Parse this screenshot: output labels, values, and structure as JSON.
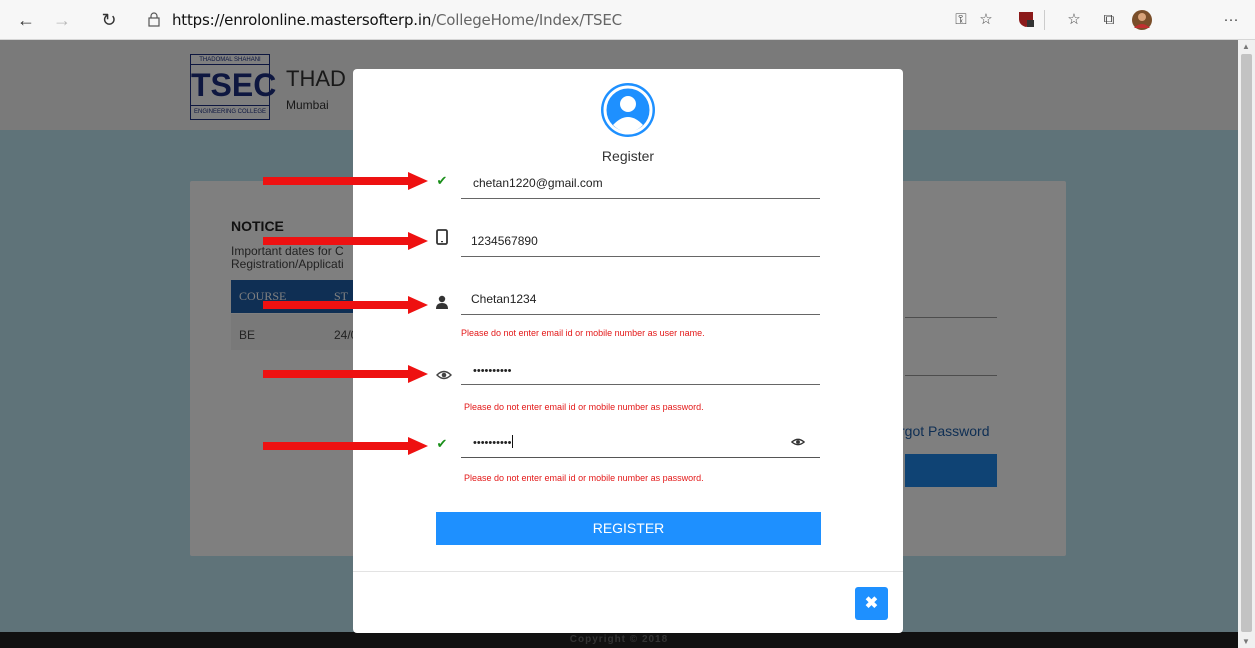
{
  "browser": {
    "url_host": "https://enrolonline.mastersofterp.in",
    "url_path": "/CollegeHome/Index/TSEC",
    "more_label": "···"
  },
  "page": {
    "logo_top": "THADOMAL SHAHANI",
    "logo_main": "TSEC",
    "logo_bottom": "ENGINEERING COLLEGE",
    "college_name": "THAD",
    "college_city": "Mumbai",
    "notice_title": "NOTICE",
    "notice_text": "Important dates for C Registration/Applicati",
    "table_headers": [
      "COURSE",
      "ST"
    ],
    "table_row": [
      "BE",
      "24/0"
    ],
    "forgot_password": "rgot Password",
    "footer": "Copyright © 2018"
  },
  "modal": {
    "title": "Register",
    "email_value": "chetan1220@gmail.com",
    "mobile_value": "1234567890",
    "username_value": "Chetan1234",
    "username_error": "Please do not enter email id or mobile number as user name.",
    "password_value": "••••••••••",
    "password_error": "Please do not enter email id or mobile number as password.",
    "confirm_value": "••••••••••",
    "confirm_error": "Please do not enter email id or mobile number as password.",
    "register_label": "REGISTER",
    "close_label": "✖"
  },
  "colors": {
    "primary": "#1e90ff",
    "error": "#e31818",
    "valid": "#1a8f1a",
    "arrow": "#ee1111"
  },
  "icons": [
    "back-icon",
    "forward-icon",
    "refresh-icon",
    "lock-icon",
    "key-icon",
    "star-icon",
    "extension-icon",
    "favorites-icon",
    "collections-icon",
    "profile-icon",
    "avatar-icon",
    "check-icon",
    "mobile-icon",
    "user-icon",
    "eye-icon",
    "close-icon"
  ]
}
